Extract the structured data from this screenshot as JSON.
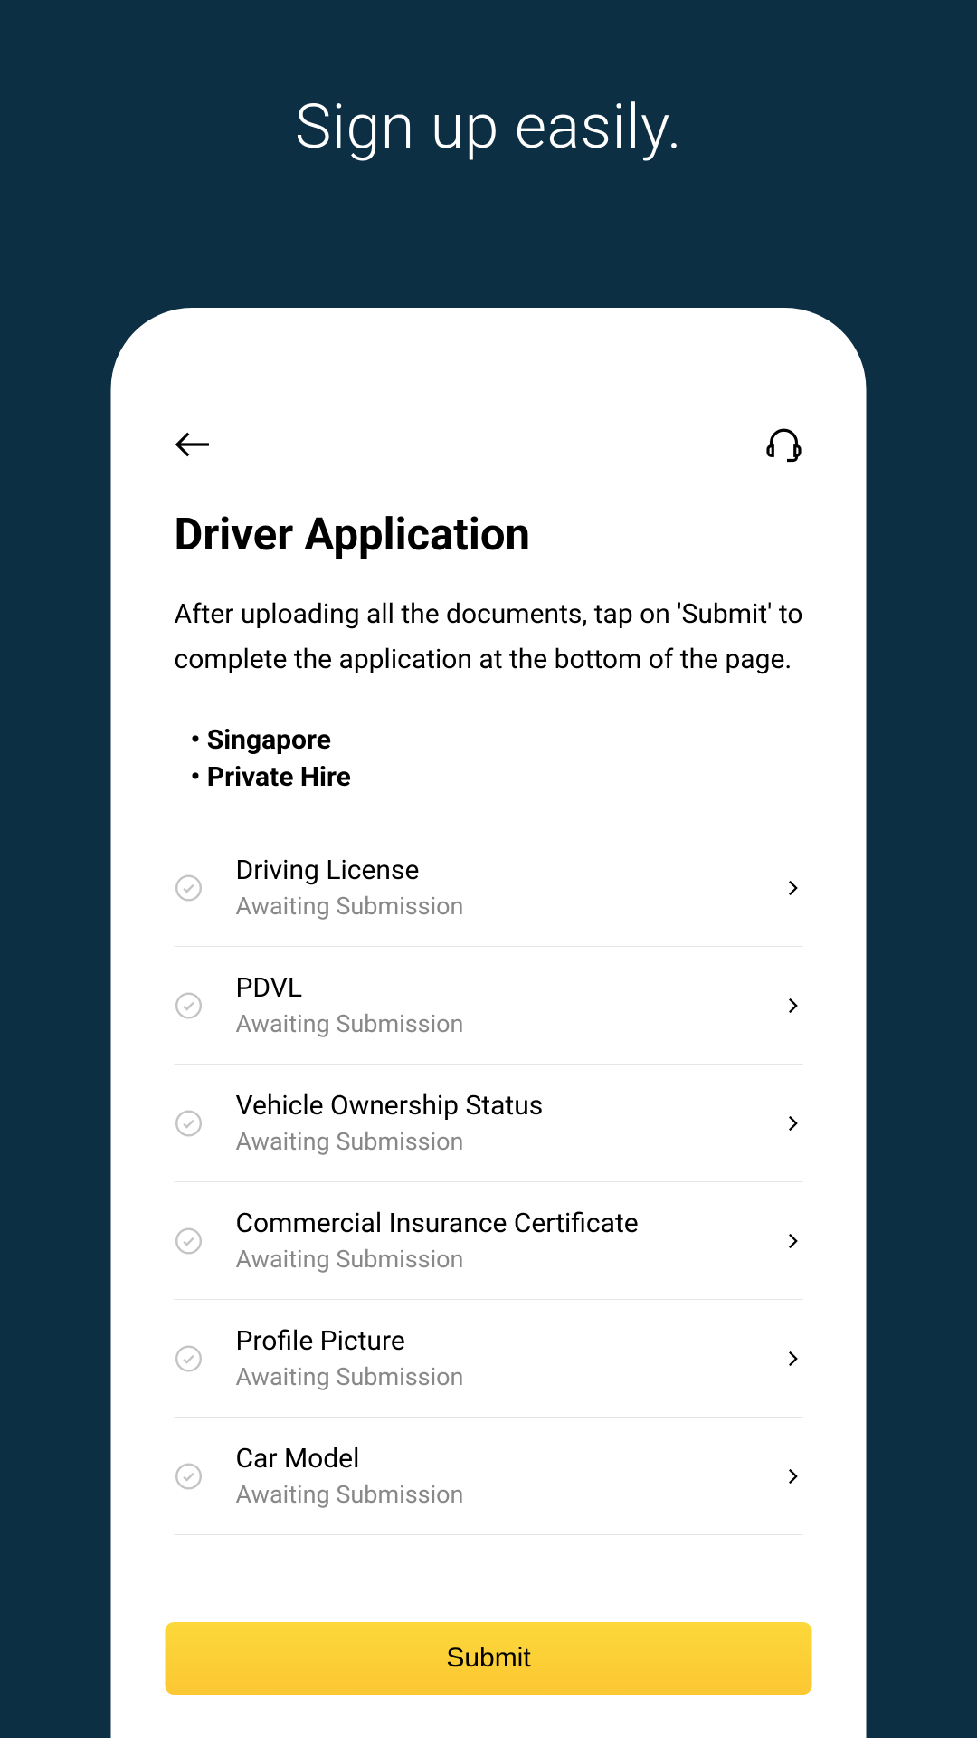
{
  "promo": {
    "title": "Sign up easily."
  },
  "header": {
    "title": "Driver Application",
    "description": "After uploading all the documents, tap on 'Submit' to complete the application at the bottom of the page."
  },
  "tags": [
    "Singapore",
    "Private Hire"
  ],
  "documents": [
    {
      "title": "Driving License",
      "status": "Awaiting Submission"
    },
    {
      "title": "PDVL",
      "status": "Awaiting Submission"
    },
    {
      "title": "Vehicle Ownership Status",
      "status": "Awaiting Submission"
    },
    {
      "title": "Commercial Insurance Certificate",
      "status": "Awaiting Submission"
    },
    {
      "title": "Profile Picture",
      "status": "Awaiting Submission"
    },
    {
      "title": "Car Model",
      "status": "Awaiting Submission"
    }
  ],
  "actions": {
    "submit_label": "Submit"
  }
}
